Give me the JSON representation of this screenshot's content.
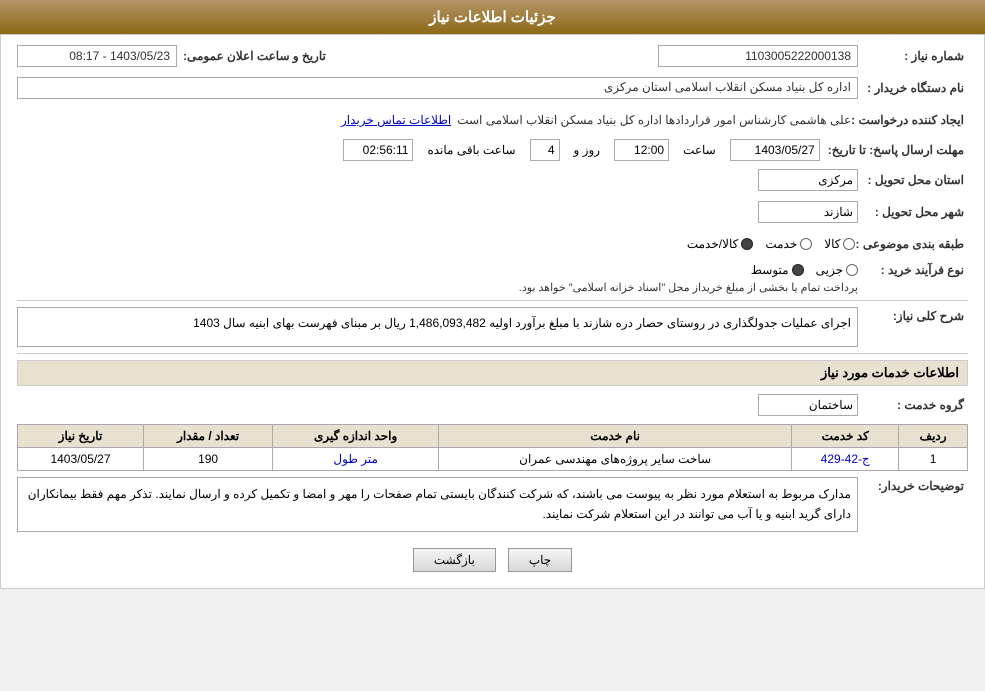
{
  "header": {
    "title": "جزئیات اطلاعات نیاز"
  },
  "fields": {
    "tender_number_label": "شماره نیاز :",
    "tender_number_value": "1103005222000138",
    "org_label": "نام دستگاه خریدار :",
    "org_value": "اداره کل بنیاد مسکن انقلاب اسلامی استان مرکزی",
    "creator_label": "ایجاد کننده درخواست :",
    "creator_value": "علی هاشمی کارشناس امور قراردادها اداره کل بنیاد مسکن انقلاب اسلامی است",
    "creator_link": "اطلاعات تماس خریدار",
    "deadline_label": "مهلت ارسال پاسخ: تا تاریخ:",
    "deadline_date": "1403/05/27",
    "deadline_time_label": "ساعت",
    "deadline_time": "12:00",
    "deadline_days_label": "روز و",
    "deadline_days": "4",
    "deadline_remaining_label": "ساعت باقی مانده",
    "deadline_remaining": "02:56:11",
    "province_label": "استان محل تحویل :",
    "province_value": "مرکزی",
    "city_label": "شهر محل تحویل :",
    "city_value": "شازند",
    "category_label": "طبقه بندی موضوعی :",
    "category_options": [
      "کالا",
      "خدمت",
      "کالا/خدمت"
    ],
    "category_selected": "کالا/خدمت",
    "process_label": "نوع فرآیند خرید :",
    "process_options": [
      "جزیی",
      "متوسط"
    ],
    "process_selected": "متوسط",
    "process_note": "پرداخت تمام یا بخشی از مبلغ خریداز محل \"اسناد خزانه اسلامی\" خواهد بود.",
    "description_label": "شرح کلی نیاز:",
    "description_value": "اجرای عملیات جدولگذاری در روستای حصار دره شازند  با مبلغ برآورد اولیه  1,486,093,482 ریال بر مبنای فهرست بهای ابنیه سال 1403",
    "services_section": "اطلاعات خدمات مورد نیاز",
    "service_group_label": "گروه خدمت :",
    "service_group_value": "ساختمان",
    "table": {
      "headers": [
        "ردیف",
        "کد خدمت",
        "نام خدمت",
        "واحد اندازه گیری",
        "تعداد / مقدار",
        "تاریخ نیاز"
      ],
      "rows": [
        {
          "row": "1",
          "code": "ج-42-429",
          "name": "ساخت سایر پروژه‌های مهندسی عمران",
          "unit": "متر طول",
          "quantity": "190",
          "date": "1403/05/27"
        }
      ]
    },
    "notes_label": "توضیحات خریدار:",
    "notes_value": "مدارک مربوط به استعلام مورد نظر به پیوست می باشند، که شرکت کنندگان بایستی تمام صفحات را مهر و امضا و تکمیل کرده و ارسال نمایند. تذکر مهم فقط بیمانکاران دارای گرید ابنیه و یا آب می توانند در این استعلام شرکت نمایند.",
    "btn_back": "بازگشت",
    "btn_print": "چاپ",
    "announce_label": "تاریخ و ساعت اعلان عمومی:",
    "announce_value": "1403/05/23 - 08:17"
  }
}
